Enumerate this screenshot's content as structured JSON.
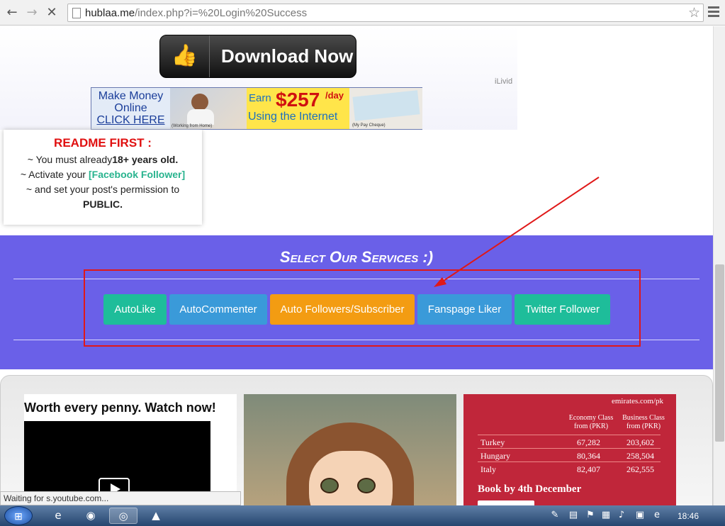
{
  "browser": {
    "url_host": "hublaa.me",
    "url_rest": "/index.php?i=%20Login%20Success",
    "back_icon": "back-arrow-icon",
    "forward_icon": "forward-arrow-icon",
    "stop_icon": "stop-icon"
  },
  "ad": {
    "download_label": "Download Now",
    "ilivid": "iLivid",
    "banner": {
      "make_money": "Make Money",
      "online": "Online",
      "click_here": "CLICK HERE",
      "working_caption": "(Working from Home)",
      "earn": "Earn",
      "amount": "$257",
      "per_day": "/day",
      "using": "Using the Internet",
      "cheque_caption": "(My Pay Cheque)"
    }
  },
  "readme": {
    "title": "README FIRST :",
    "line1_pre": "~ You must already",
    "line1_bold": "18+ years old.",
    "line2_pre": "~ Activate your ",
    "line2_link": "[Facebook Follower]",
    "line3": "~ and set your post's permission to",
    "line4": "PUBLIC."
  },
  "services": {
    "heading": "Select Our Services :)",
    "buttons": [
      {
        "label": "AutoLike",
        "color": "#1ebd9a"
      },
      {
        "label": "AutoCommenter",
        "color": "#3a9ad9"
      },
      {
        "label": "Auto Followers/Subscriber",
        "color": "#f39c12"
      },
      {
        "label": "Fanspage Liker",
        "color": "#3a9ad9"
      },
      {
        "label": "Twitter Follower",
        "color": "#1ebd9a"
      }
    ]
  },
  "gallery": {
    "video_title": "Worth every penny. Watch now!",
    "emirates": {
      "site": "emirates.com/pk",
      "col1": "Economy Class from (PKR)",
      "col2": "Business Class from (PKR)",
      "rows": [
        {
          "city": "Turkey",
          "economy": "67,282",
          "business": "203,602"
        },
        {
          "city": "Hungary",
          "economy": "80,364",
          "business": "258,504"
        },
        {
          "city": "Italy",
          "economy": "82,407",
          "business": "262,555"
        }
      ],
      "book": "Book by 4th December"
    }
  },
  "status_text": "Waiting for s.youtube.com...",
  "taskbar": {
    "clock": "18:46"
  },
  "colors": {
    "services_bg": "#6a60e8",
    "highlight_box": "#e01818",
    "readme_title": "#e01010"
  }
}
